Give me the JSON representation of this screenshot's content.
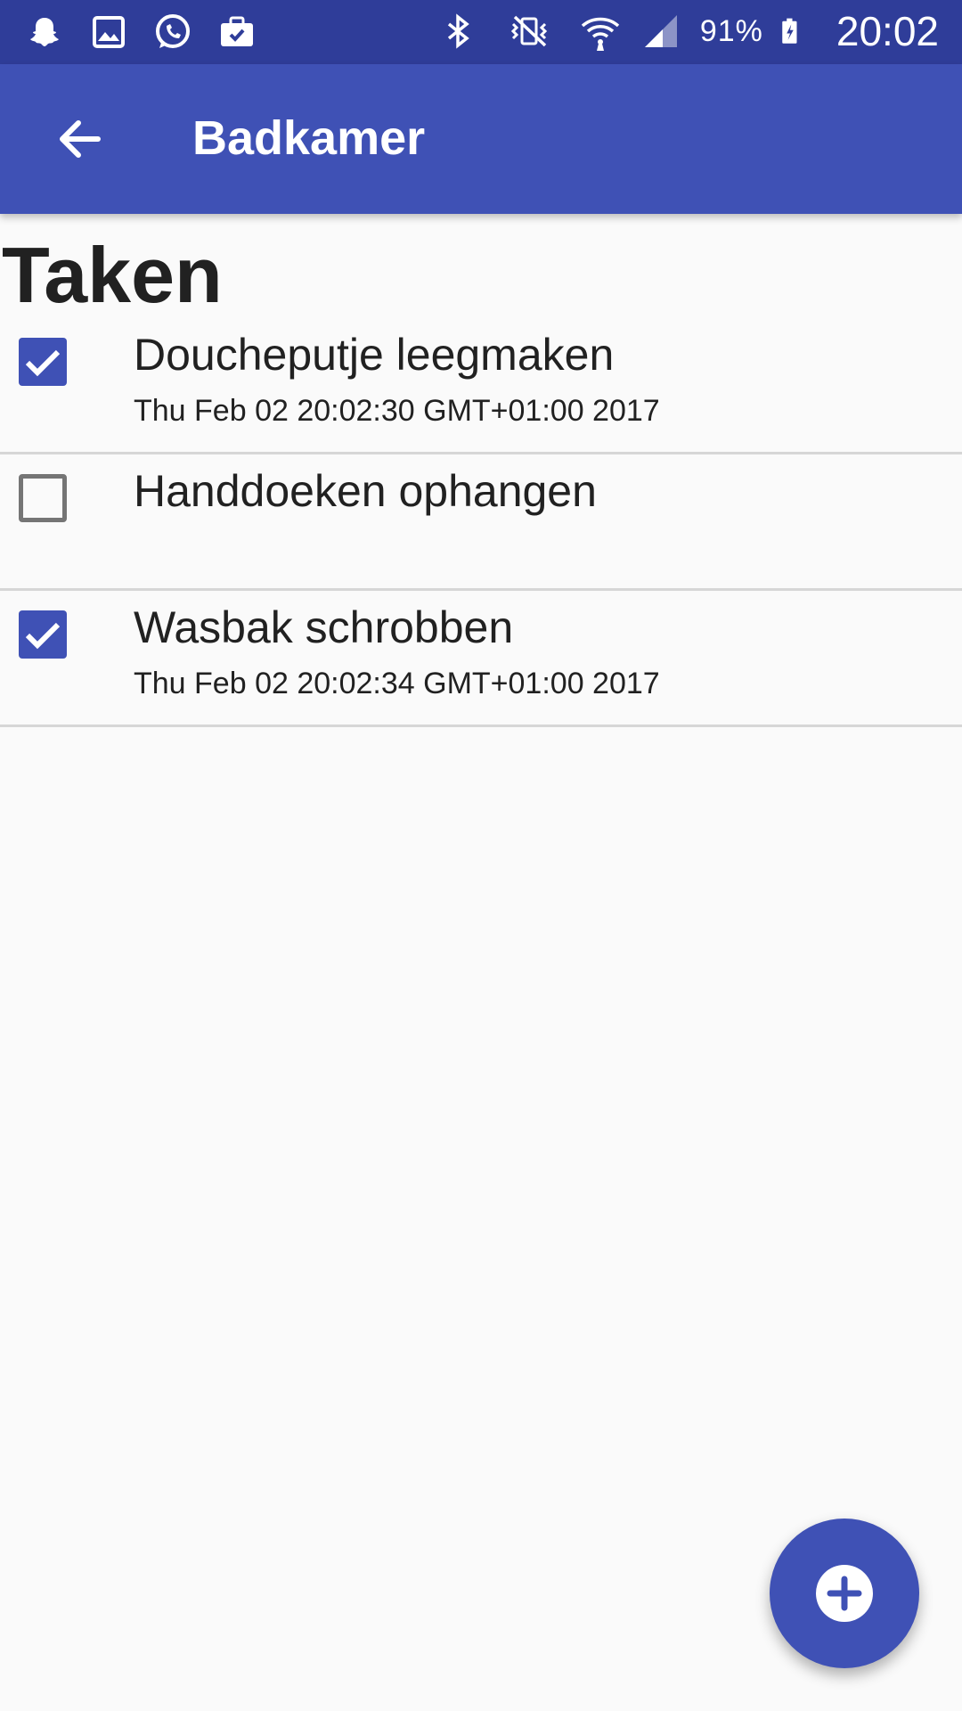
{
  "status_bar": {
    "battery_percent": "91%",
    "time": "20:02",
    "left_icons": [
      "snapchat-icon",
      "gallery-icon",
      "whatsapp-icon",
      "work-bag-icon"
    ],
    "right_icons": [
      "bluetooth-icon",
      "silent-vibrate-icon",
      "wifi-icon",
      "signal-icon",
      "battery-charging-icon"
    ]
  },
  "app_bar": {
    "title": "Badkamer",
    "back_icon": "arrow-back-icon"
  },
  "section": {
    "heading": "Taken"
  },
  "tasks": [
    {
      "title": "Doucheputje leegmaken",
      "date": "Thu Feb 02 20:02:30 GMT+01:00 2017",
      "checked": true
    },
    {
      "title": "Handdoeken ophangen",
      "date": "",
      "checked": false
    },
    {
      "title": "Wasbak schrobben",
      "date": "Thu Feb 02 20:02:34 GMT+01:00 2017",
      "checked": true
    }
  ],
  "fab": {
    "icon": "add-circle-icon"
  },
  "colors": {
    "primary": "#3f51b5",
    "primary_dark": "#2f3d99",
    "background": "#fafafa",
    "text": "#212121"
  }
}
